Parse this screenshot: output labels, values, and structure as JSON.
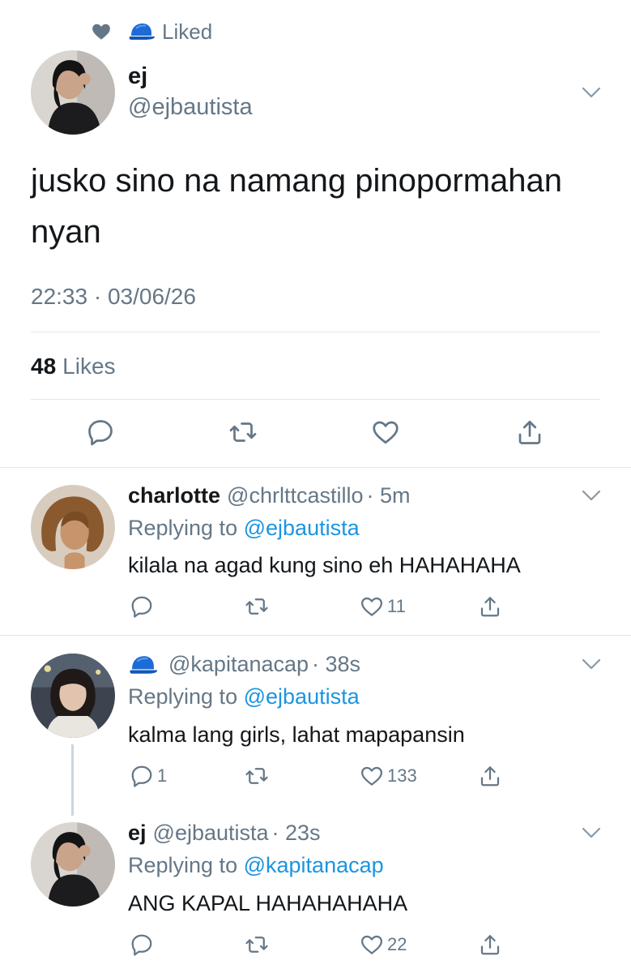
{
  "header": {
    "liked_label": "Liked"
  },
  "main_tweet": {
    "name": "ej",
    "handle": "@ejbautista",
    "text": "jusko sino na namang pinopormahan nyan",
    "timestamp": "22:33 · 03/06/26",
    "likes_count": "48",
    "likes_label": "Likes"
  },
  "replies": [
    {
      "name": "charlotte",
      "handle": "@chrlttcastillo",
      "time": "· 5m",
      "replying_prefix": "Replying to",
      "replying_to": "@ejbautista",
      "text": "kilala na agad kung sino eh HAHAHAHA",
      "reply_count": "",
      "like_count": "11"
    },
    {
      "name": "",
      "handle": "@kapitanacap",
      "time": "· 38s",
      "replying_prefix": "Replying to",
      "replying_to": "@ejbautista",
      "text": "kalma lang girls, lahat mapapansin",
      "reply_count": "1",
      "like_count": "133"
    },
    {
      "name": "ej",
      "handle": "@ejbautista",
      "time": "· 23s",
      "replying_prefix": "Replying to",
      "replying_to": "@kapitanacap",
      "text": "ANG KAPAL HAHAHAHAHA",
      "reply_count": "",
      "like_count": "22"
    }
  ],
  "colors": {
    "muted": "#657786",
    "link": "#1b95e0",
    "text": "#14171a",
    "cap_blue": "#1d6bd6"
  },
  "icons": [
    "heart-icon",
    "blue-cap-icon",
    "chevron-down-icon",
    "reply-icon",
    "retweet-icon",
    "like-icon",
    "share-icon"
  ]
}
